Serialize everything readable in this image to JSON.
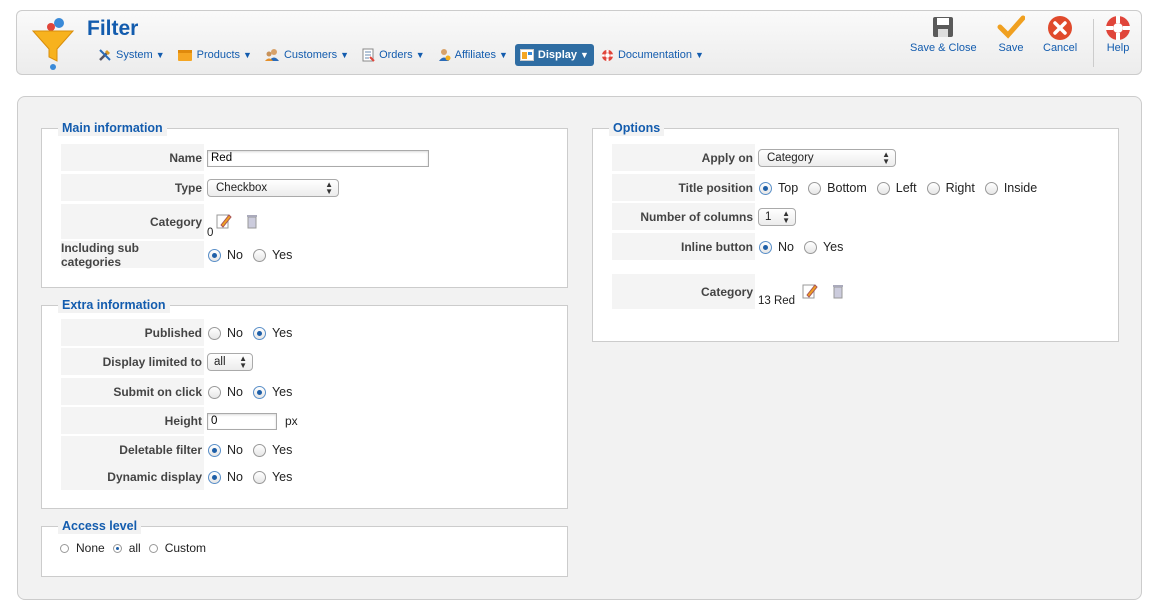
{
  "header": {
    "title": "Filter",
    "nav": [
      {
        "label": "System",
        "icon": "tools-icon"
      },
      {
        "label": "Products",
        "icon": "products-icon"
      },
      {
        "label": "Customers",
        "icon": "customers-icon"
      },
      {
        "label": "Orders",
        "icon": "orders-icon"
      },
      {
        "label": "Affiliates",
        "icon": "affiliates-icon"
      },
      {
        "label": "Display",
        "icon": "display-icon"
      },
      {
        "label": "Documentation",
        "icon": "lifebuoy-icon"
      }
    ],
    "toolbar": {
      "save_close": "Save & Close",
      "save": "Save",
      "cancel": "Cancel",
      "help": "Help"
    }
  },
  "main_info": {
    "legend": "Main information",
    "name_label": "Name",
    "name_value": "Red",
    "type_label": "Type",
    "type_value": "Checkbox",
    "category_label": "Category",
    "category_value": "0",
    "subcat_label": "Including sub categories",
    "no": "No",
    "yes": "Yes"
  },
  "extra_info": {
    "legend": "Extra information",
    "published_label": "Published",
    "display_limited_label": "Display limited to",
    "display_limited_value": "all",
    "submit_label": "Submit on click",
    "height_label": "Height",
    "height_value": "0",
    "height_unit": "px",
    "deletable_label": "Deletable filter",
    "dynamic_label": "Dynamic display",
    "no": "No",
    "yes": "Yes"
  },
  "access": {
    "legend": "Access level",
    "none": "None",
    "all": "all",
    "custom": "Custom"
  },
  "options": {
    "legend": "Options",
    "apply_label": "Apply on",
    "apply_value": "Category",
    "title_pos_label": "Title position",
    "top": "Top",
    "bottom": "Bottom",
    "left": "Left",
    "right": "Right",
    "inside": "Inside",
    "columns_label": "Number of columns",
    "columns_value": "1",
    "inline_label": "Inline button",
    "no": "No",
    "yes": "Yes",
    "category_label": "Category",
    "category_value": "13 Red"
  },
  "colors": {
    "accent": "#135cae",
    "active_nav": "#2f6da3",
    "cancel": "#e04a2c",
    "save_check": "#f0a020"
  }
}
